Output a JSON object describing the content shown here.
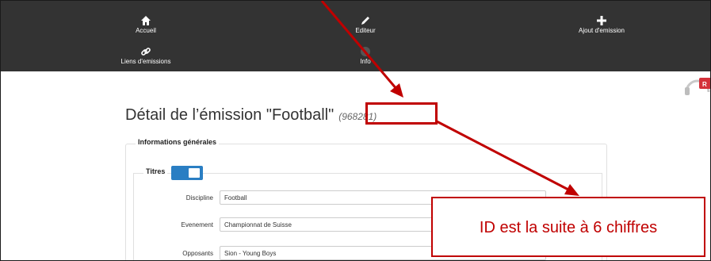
{
  "nav": {
    "accueil": "Accueil",
    "editeur": "Editeur",
    "ajout": "Ajout d'emission",
    "liens": "Liens d'emissions",
    "info": "Info"
  },
  "page": {
    "title": "Détail de l’émission \"Football\"",
    "emission_id": "(968281)"
  },
  "sections": {
    "info_legend": "Informations générales",
    "titres_legend": "Titres",
    "titres_toggle_on": true
  },
  "fields": [
    {
      "label": "Discipline",
      "value": "Football"
    },
    {
      "label": "Evenement",
      "value": "Championnat de Suisse"
    },
    {
      "label": "Opposants",
      "value": "Sion - Young Boys"
    }
  ],
  "annotation": {
    "callout_text": "ID est la suite à 6 chiffres",
    "color": "#c00000"
  },
  "colors": {
    "nav_bg": "#333333",
    "toggle_blue": "#2a7ec3"
  },
  "icons": {
    "accueil": "home-icon",
    "editeur": "pencil-icon",
    "ajout": "plus-icon",
    "liens": "link-icon",
    "logo": "headphones-logo-icon"
  }
}
